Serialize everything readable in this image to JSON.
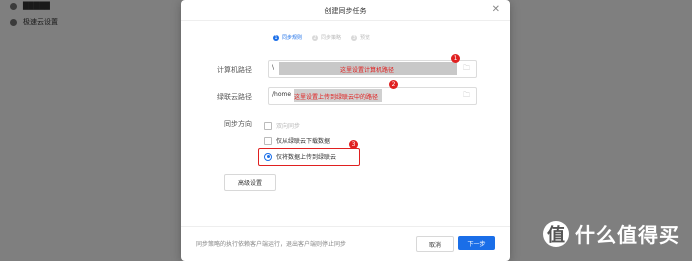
{
  "background": {
    "sidebar_items": [
      {
        "label": "█████"
      },
      {
        "label": "极速云设置"
      }
    ]
  },
  "dialog": {
    "title": "创建同步任务",
    "close_icon": "close-icon",
    "steps": [
      {
        "num": "1",
        "label": "同步规则",
        "active": true
      },
      {
        "num": "2",
        "label": "同步策略",
        "active": false
      },
      {
        "num": "3",
        "label": "预览",
        "active": false
      }
    ],
    "computer_path": {
      "label": "计算机路径",
      "value": "\\",
      "annotation": "这里设置计算机路径",
      "badge": "1"
    },
    "cloud_path": {
      "label": "绿联云路径",
      "value": "/home",
      "annotation": "这里设置上传到绿联云中的路径",
      "badge": "2"
    },
    "sync_direction": {
      "label": "同步方向",
      "options": [
        {
          "label": "双向同步",
          "state": "disabled"
        },
        {
          "label": "仅从绿联云下载数据",
          "state": "checkbox"
        },
        {
          "label": "仅将数据上传到绿联云",
          "state": "selected"
        }
      ],
      "badge": "3"
    },
    "advanced_button": "高级设置",
    "footnote": "同步策略的执行依赖客户端运行，退出客户端则停止同步",
    "cancel_button": "取消",
    "next_button": "下一步"
  },
  "watermark": {
    "logo_glyph": "值",
    "text": "什么值得买"
  },
  "colors": {
    "accent": "#1a6ee8",
    "annotation_red": "#e02020"
  }
}
